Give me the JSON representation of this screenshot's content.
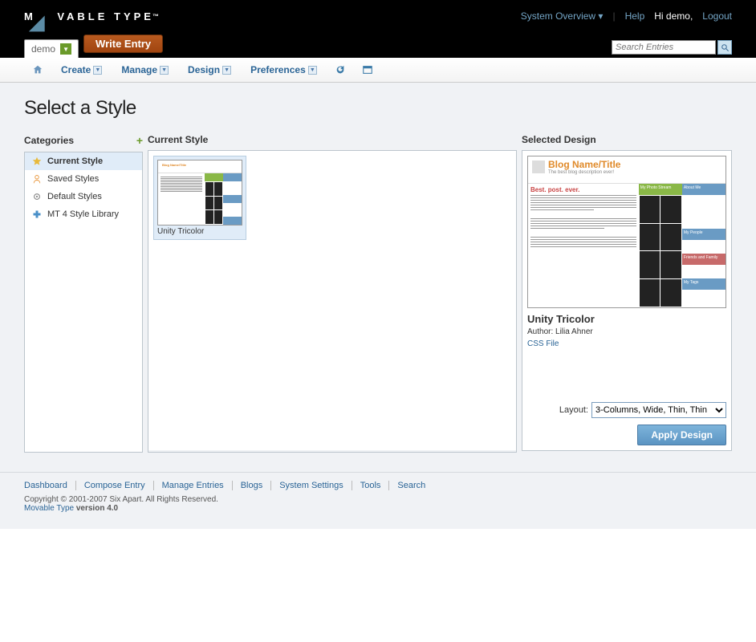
{
  "header": {
    "logo_text": "MOVABLE TYPE",
    "system_overview": "System Overview",
    "help": "Help",
    "greeting": "Hi demo,",
    "logout": "Logout",
    "blog_selector": "demo",
    "write_entry": "Write Entry",
    "search_placeholder": "Search Entries"
  },
  "nav": {
    "create": "Create",
    "manage": "Manage",
    "design": "Design",
    "preferences": "Preferences"
  },
  "page": {
    "title": "Select a Style",
    "categories_label": "Categories",
    "current_style_label": "Current Style",
    "selected_design_label": "Selected Design"
  },
  "categories": [
    {
      "label": "Current Style"
    },
    {
      "label": "Saved Styles"
    },
    {
      "label": "Default Styles"
    },
    {
      "label": "MT 4 Style Library"
    }
  ],
  "current_style_thumb": {
    "name": "Unity Tricolor"
  },
  "preview": {
    "blog_title": "Blog Name/Title",
    "blog_subtitle": "The best blog description ever!",
    "post_title": "Best. post. ever.",
    "side_photos": "My Photo Stream",
    "side_about": "About Me",
    "side_people": "My People",
    "side_friends": "Friends and Family",
    "side_tags": "My Tags"
  },
  "selected": {
    "name": "Unity Tricolor",
    "author": "Author: Lilia Ahner",
    "css_link": "CSS File",
    "layout_label": "Layout:",
    "layout_value": "3-Columns, Wide, Thin, Thin",
    "apply": "Apply Design"
  },
  "footer": {
    "links": [
      "Dashboard",
      "Compose Entry",
      "Manage Entries",
      "Blogs",
      "System Settings",
      "Tools",
      "Search"
    ],
    "copyright": "Copyright © 2001-2007 Six Apart. All Rights Reserved.",
    "mt_link": "Movable Type",
    "version": " version 4.0"
  }
}
